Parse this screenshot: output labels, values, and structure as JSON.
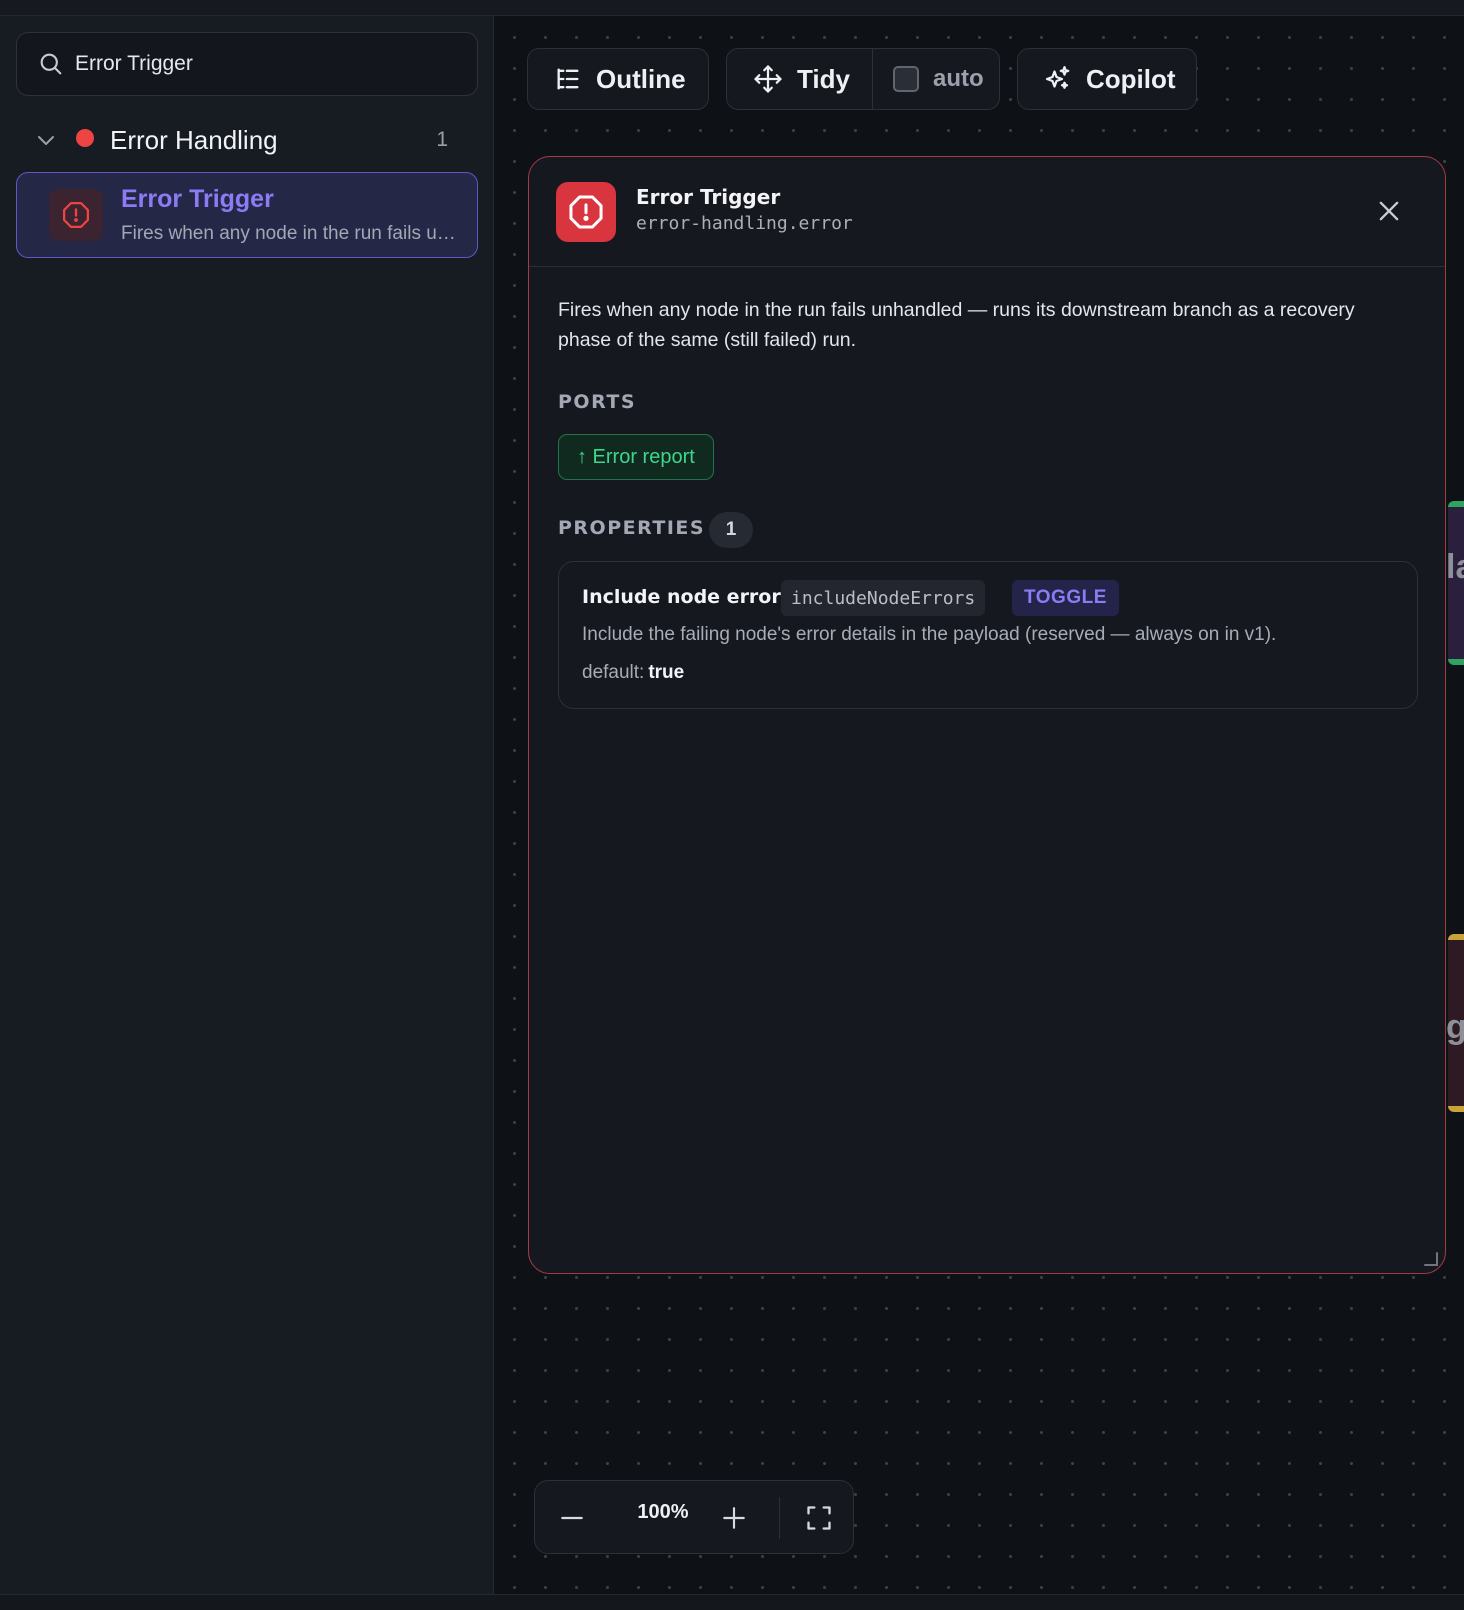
{
  "sidebar": {
    "search": {
      "value": "Error Trigger",
      "icon": "search-icon"
    },
    "group": {
      "label": "Error Handling",
      "count": "1",
      "dot_color": "#ef4444"
    },
    "item": {
      "title": "Error Trigger",
      "description": "Fires when any node in the run fails unhandled — runs its downstream branch as a recovery phase of the same (still failed) run.",
      "icon": "alert-octagon-icon"
    }
  },
  "toolbar": {
    "outline_label": "Outline",
    "tidy_label": "Tidy",
    "auto_label": "auto",
    "auto_checked": false,
    "copilot_label": "Copilot"
  },
  "panel": {
    "title": "Error Trigger",
    "subtitle": "error-handling.error",
    "icon": "alert-octagon-icon",
    "accent_color": "#d9353f",
    "description": "Fires when any node in the run fails unhandled — runs its downstream branch as a recovery phase of the same (still failed) run.",
    "ports_label": "PORTS",
    "ports": [
      {
        "label": "↑ Error report",
        "color": "#3dd68c"
      }
    ],
    "properties_label": "PROPERTIES",
    "properties_count": "1",
    "properties": [
      {
        "name": "Include node errors",
        "key": "includeNodeErrors",
        "type": "TOGGLE",
        "description": "Include the failing node's error details in the payload (reserved — always on in v1).",
        "default_label": "default:",
        "default_value": "true"
      }
    ]
  },
  "canvas": {
    "edge_nodes": [
      {
        "text": "la"
      },
      {
        "text": "g"
      }
    ]
  },
  "zoom": {
    "level": "100%"
  }
}
